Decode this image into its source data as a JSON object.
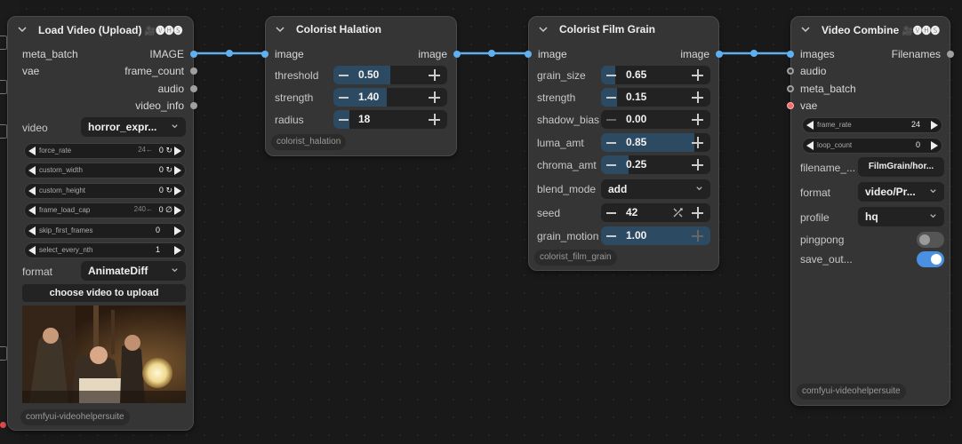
{
  "load_video": {
    "title": "Load Video (Upload)",
    "badge": "🎥🅥🅗🅢",
    "inputs": [
      "meta_batch",
      "vae"
    ],
    "outputs": [
      "IMAGE",
      "frame_count",
      "audio",
      "video_info"
    ],
    "video_label": "video",
    "video_value": "horror_expr...",
    "params": [
      {
        "label": "force_rate",
        "ghost": "24←",
        "value": "0",
        "glyph": "↻"
      },
      {
        "label": "custom_width",
        "ghost": "",
        "value": "0",
        "glyph": "↻"
      },
      {
        "label": "custom_height",
        "ghost": "",
        "value": "0",
        "glyph": "↻"
      },
      {
        "label": "frame_load_cap",
        "ghost": "240←",
        "value": "0",
        "glyph": "∅"
      },
      {
        "label": "skip_first_frames",
        "ghost": "",
        "value": "0",
        "glyph": ""
      },
      {
        "label": "select_every_nth",
        "ghost": "",
        "value": "1",
        "glyph": ""
      }
    ],
    "format_label": "format",
    "format_value": "AnimateDiff",
    "upload_button": "choose video to upload",
    "footer": "comfyui-videohelpersuite"
  },
  "halation": {
    "title": "Colorist Halation",
    "input": "image",
    "output": "image",
    "params": [
      {
        "label": "threshold",
        "value": "0.50",
        "level": 0.5
      },
      {
        "label": "strength",
        "value": "1.40",
        "level": 0.47
      },
      {
        "label": "radius",
        "value": "18",
        "level": 0.14
      }
    ],
    "footer": "colorist_halation"
  },
  "film_grain": {
    "title": "Colorist Film Grain",
    "input": "image",
    "output": "image",
    "params": [
      {
        "label": "grain_size",
        "value": "0.65",
        "level": 0.13
      },
      {
        "label": "strength",
        "value": "0.15",
        "level": 0.15
      },
      {
        "label": "shadow_bias",
        "value": "0.00",
        "level": 0.0
      },
      {
        "label": "luma_amt",
        "value": "0.85",
        "level": 0.85
      },
      {
        "label": "chroma_amt",
        "value": "0.25",
        "level": 0.25
      }
    ],
    "blend_label": "blend_mode",
    "blend_value": "add",
    "seed_label": "seed",
    "seed_value": "42",
    "motion_label": "grain_motion",
    "motion_value": "1.00",
    "motion_level": 1.0,
    "footer": "colorist_film_grain"
  },
  "video_combine": {
    "title": "Video Combine",
    "badge": "🎥🅥🅗🅢",
    "inputs": [
      "images",
      "audio",
      "meta_batch",
      "vae"
    ],
    "output": "Filenames",
    "frame_rate_label": "frame_rate",
    "frame_rate_value": "24",
    "loop_count_label": "loop_count",
    "loop_count_value": "0",
    "filename_label": "filename_...",
    "filename_value": "FilmGrain/hor...",
    "format_label": "format",
    "format_value": "video/Pr...",
    "profile_label": "profile",
    "profile_value": "hq",
    "pingpong_label": "pingpong",
    "pingpong_on": false,
    "save_label": "save_out...",
    "save_on": true,
    "footer": "comfyui-videohelpersuite"
  },
  "colors": {
    "link": "#60b0f0",
    "toggle_on": "#4a90e2",
    "toggle_off": "#555555"
  }
}
